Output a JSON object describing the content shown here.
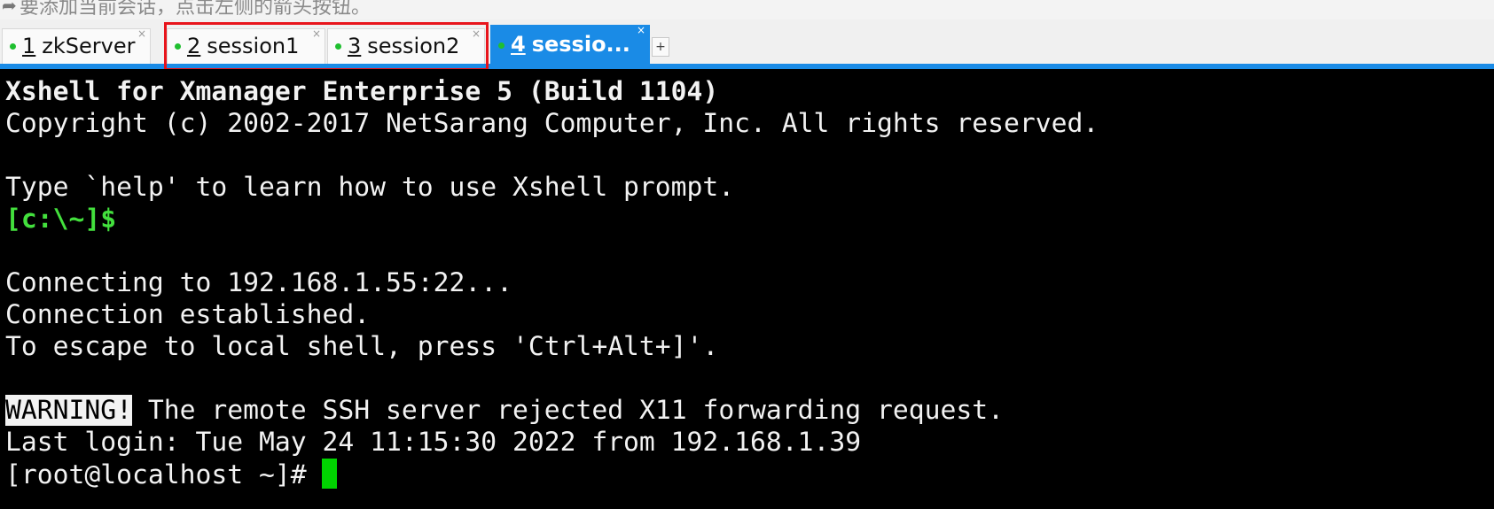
{
  "topbar": {
    "hint": "要添加当前会话，点击左侧的箭头按钮。"
  },
  "tabs": [
    {
      "num": "1",
      "name": "zkServer",
      "close": "×"
    },
    {
      "num": "2",
      "name": "session1",
      "close": "×"
    },
    {
      "num": "3",
      "name": "session2",
      "close": "×"
    },
    {
      "num": "4",
      "name": "sessio...",
      "close": "×"
    }
  ],
  "add_tab": "+",
  "terminal": {
    "banner": "Xshell for Xmanager Enterprise 5 (Build 1104)",
    "copyright": "Copyright (c) 2002-2017 NetSarang Computer, Inc. All rights reserved.",
    "help": "Type `help' to learn how to use Xshell prompt.",
    "local_prompt": "[c:\\~]$",
    "connecting": "Connecting to 192.168.1.55:22...",
    "established": "Connection established.",
    "escape": "To escape to local shell, press 'Ctrl+Alt+]'.",
    "warning_tag": "WARNING!",
    "warning_text": " The remote SSH server rejected X11 forwarding request.",
    "last_login": "Last login: Tue May 24 11:15:30 2022 from 192.168.1.39",
    "remote_prompt": "[root@localhost ~]# "
  },
  "colors": {
    "tab_active": "#1a8be6",
    "status_dot": "#1fbf2f",
    "highlight_border": "#e8141b",
    "prompt_green": "#43e03d",
    "cursor": "#00d400"
  }
}
